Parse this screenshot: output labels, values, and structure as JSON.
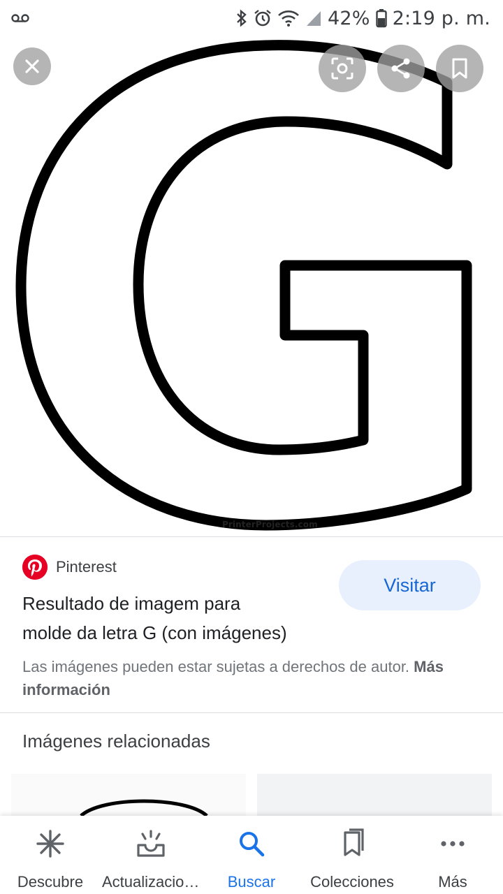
{
  "status_bar": {
    "battery": "42%",
    "time": "2:19 p. m.",
    "icons": [
      "voicemail-icon",
      "bluetooth-icon",
      "alarm-icon",
      "wifi-icon",
      "signal-icon",
      "battery-icon"
    ]
  },
  "image_viewer": {
    "watermark": "PrinterProjects.com",
    "buttons": [
      "close-icon",
      "lens-icon",
      "share-icon",
      "bookmark-icon"
    ]
  },
  "result": {
    "source": "Pinterest",
    "title_line1": "Resultado de imagem para",
    "title_line2": "molde da letra G (con imágenes)",
    "visit_label": "Visitar",
    "copyright_text": "Las imágenes pueden estar sujetas a derechos de autor.",
    "more_info": "Más información"
  },
  "related": {
    "title": "Imágenes relacionadas"
  },
  "bottom_nav": {
    "items": [
      {
        "label": "Descubre",
        "icon": "discover-icon"
      },
      {
        "label": "Actualizaciones",
        "icon": "updates-icon"
      },
      {
        "label": "Buscar",
        "icon": "search-icon",
        "active": true
      },
      {
        "label": "Colecciones",
        "icon": "collections-icon"
      },
      {
        "label": "Más",
        "icon": "more-icon"
      }
    ],
    "active_color": "#1a73e8"
  }
}
